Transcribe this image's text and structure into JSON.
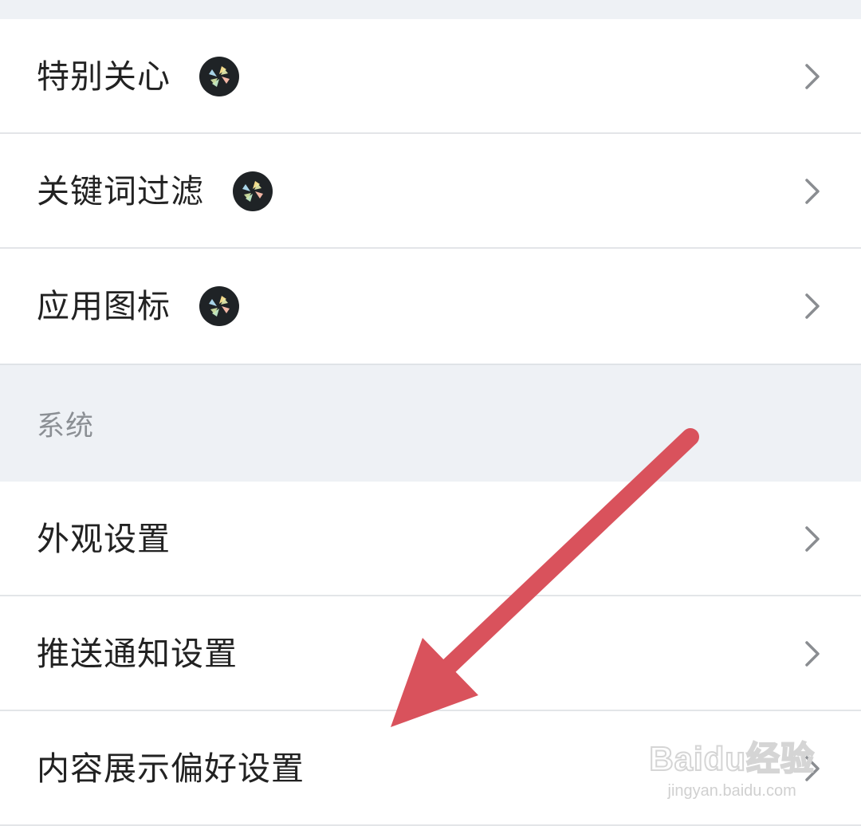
{
  "groups": [
    {
      "items": [
        {
          "label": "特别关心",
          "badge_icon": "pinwheel-badge-icon"
        },
        {
          "label": "关键词过滤",
          "badge_icon": "pinwheel-badge-icon"
        },
        {
          "label": "应用图标",
          "badge_icon": "pinwheel-badge-icon"
        }
      ]
    }
  ],
  "section": {
    "title": "系统"
  },
  "system_items": [
    {
      "label": "外观设置"
    },
    {
      "label": "推送通知设置"
    },
    {
      "label": "内容展示偏好设置"
    }
  ],
  "colors": {
    "background": "#eef1f5",
    "row": "#ffffff",
    "text": "#222222",
    "section_text": "#8b8f94",
    "annotation_arrow": "#d9525c"
  },
  "watermark": {
    "main": "Baidu经验",
    "sub": "jingyan.baidu.com"
  }
}
